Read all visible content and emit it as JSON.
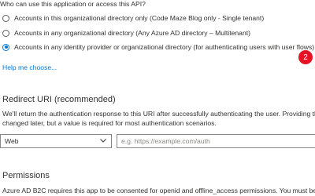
{
  "question": "Who can use this application or access this API?",
  "account_options": [
    {
      "label": "Accounts in this organizational directory only (Code Maze Blog only - Single tenant)",
      "selected": false
    },
    {
      "label": "Accounts in any organizational directory (Any Azure AD directory – Multitenant)",
      "selected": false
    },
    {
      "label": "Accounts in any identity provider or organizational directory (for authenticating users with user flows)",
      "selected": true
    }
  ],
  "badge": "2",
  "help_link": "Help me choose...",
  "redirect": {
    "heading": "Redirect URI (recommended)",
    "description_line1": "We'll return the authentication response to this URI after successfully authenticating the user. Providing this",
    "description_line2": "changed later, but a value is required for most authentication scenarios.",
    "platform_selected": "Web",
    "uri_placeholder": "e.g. https://example.com/auth",
    "uri_value": ""
  },
  "permissions": {
    "heading": "Permissions",
    "description": "Azure AD B2C requires this app to be consented for openid and offline_access permissions. You must be an"
  },
  "colors": {
    "accent": "#0078d4",
    "badge": "#e81123",
    "text": "#323130"
  }
}
